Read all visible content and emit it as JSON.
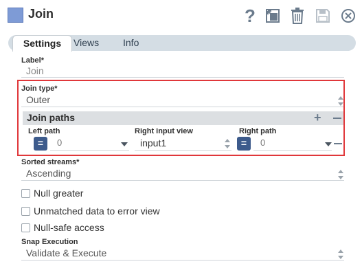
{
  "header": {
    "title": "Join",
    "help_glyph": "?",
    "icons": [
      "export-icon",
      "trash-icon",
      "save-icon",
      "close-icon"
    ]
  },
  "tabs": [
    {
      "label": "Settings",
      "active": true
    },
    {
      "label": "Views",
      "active": false
    },
    {
      "label": "Info",
      "active": false
    }
  ],
  "fields": {
    "label": {
      "label": "Label*",
      "value": "Join"
    },
    "join_type": {
      "label": "Join type*",
      "value": "Outer"
    },
    "join_paths": {
      "title": "Join paths",
      "add_glyph": "+",
      "left_path": {
        "label": "Left path",
        "value": "0",
        "eq": "="
      },
      "right_input_view": {
        "label": "Right input view",
        "value": "input1"
      },
      "right_path": {
        "label": "Right path",
        "value": "0",
        "eq": "="
      }
    },
    "sorted_streams": {
      "label": "Sorted streams*",
      "value": "Ascending"
    },
    "checkboxes": [
      {
        "label": "Null greater",
        "checked": false
      },
      {
        "label": "Unmatched data to error view",
        "checked": false
      },
      {
        "label": "Null-safe access",
        "checked": false
      }
    ],
    "snap_execution": {
      "label": "Snap Execution",
      "value": "Validate & Execute"
    }
  },
  "colors": {
    "highlight": "#e0373a",
    "eq_button": "#3d5b8c",
    "snap_icon": "#7e9bd6"
  }
}
